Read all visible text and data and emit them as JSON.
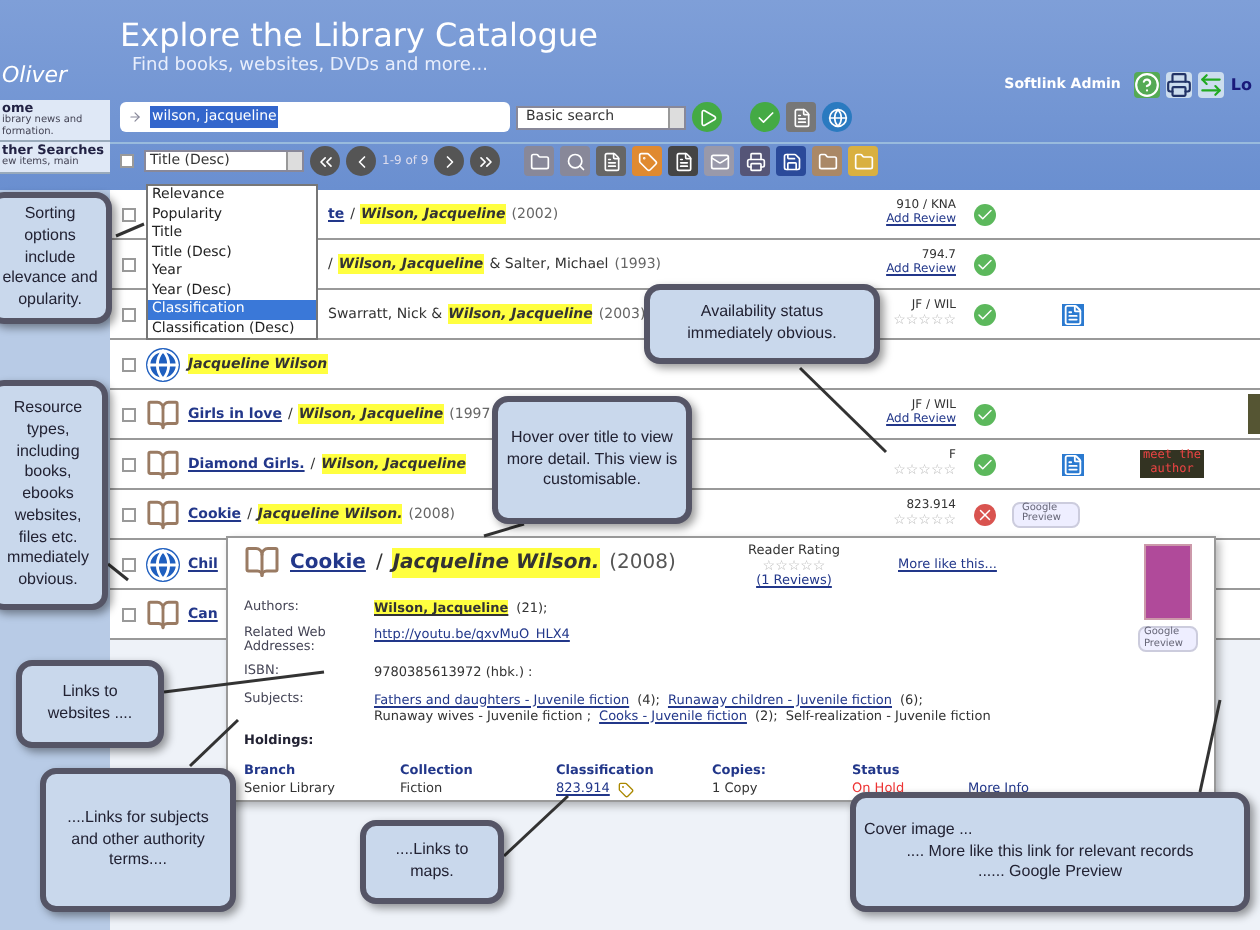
{
  "header": {
    "logo": "Oliver",
    "title": "Explore the Library Catalogue",
    "subtitle": "Find books, websites, DVDs and more...",
    "user": "Softlink Admin",
    "logout": "Lo"
  },
  "sidebar": {
    "items": [
      {
        "label": "ome",
        "description": "ibrary news and formation."
      },
      {
        "label": "ther Searches",
        "description": "ew items, main"
      }
    ]
  },
  "search": {
    "value": "wilson, jacqueline",
    "mode": "Basic search"
  },
  "toolbar": {
    "select_all_checked": false,
    "sort": "Title (Desc)",
    "pager": "1-9 of 9"
  },
  "sort_menu": [
    {
      "label": "Relevance",
      "selected": false
    },
    {
      "label": "Popularity",
      "selected": false
    },
    {
      "label": "Title",
      "selected": false
    },
    {
      "label": "Title (Desc)",
      "selected": false
    },
    {
      "label": "Year",
      "selected": false
    },
    {
      "label": "Year (Desc)",
      "selected": false
    },
    {
      "label": "Classification",
      "selected": true
    },
    {
      "label": "Classification (Desc)",
      "selected": false
    }
  ],
  "results": [
    {
      "checked": false,
      "title": "te",
      "separator": "/",
      "author": "Wilson, Jacqueline",
      "year": "(2002)",
      "call_number": "910 / KNA",
      "review": "Add Review",
      "available": true
    },
    {
      "checked": false,
      "separator": "/",
      "author": "Wilson, Jacqueline",
      "others": "& Salter, Michael",
      "year": "(1993)",
      "call_number": "794.7",
      "review": "Add Review",
      "available": true
    },
    {
      "checked": false,
      "others_before": "Swarratt, Nick &",
      "author": "Wilson, Jacqueline",
      "year": "(2003)",
      "call_number": "JF / WIL",
      "stars": 0,
      "available": true,
      "attachment": true
    },
    {
      "checked": false,
      "kind": "website",
      "author": "Jacqueline Wilson"
    },
    {
      "checked": false,
      "kind": "book",
      "title": "Girls in love",
      "separator": "/",
      "author": "Wilson, Jacqueline",
      "year": "(1997",
      "call_number": "JF / WIL",
      "review": "Add Review",
      "available": true,
      "cover": true
    },
    {
      "checked": false,
      "kind": "book",
      "title": "Diamond Girls.",
      "separator": "/",
      "author": "Wilson, Jacqueline",
      "call_number": "F",
      "stars": 0,
      "available": true,
      "attachment": true,
      "author_image": "meet the author"
    },
    {
      "checked": false,
      "kind": "book",
      "title": "Cookie",
      "separator": "/",
      "author": "Jacqueline Wilson.",
      "year": "(2008)",
      "call_number": "823.914",
      "stars": 0,
      "available": false,
      "preview": "Google Preview"
    },
    {
      "checked": false,
      "kind": "website",
      "title": "Chil"
    },
    {
      "checked": false,
      "kind": "book",
      "title": "Can"
    }
  ],
  "detail": {
    "title": "Cookie",
    "separator": "/",
    "author": "Jacqueline Wilson.",
    "year": "(2008)",
    "rating_label": "Reader Rating",
    "stars": 0,
    "reviews": "(1 Reviews)",
    "more_like": "More like this...",
    "preview": "Google Preview",
    "fields": [
      {
        "label": "Authors:",
        "parts": [
          {
            "text": "Wilson, Jacqueline",
            "kind": "highlight"
          },
          {
            "text": "(21);",
            "kind": "plain"
          }
        ]
      },
      {
        "label": "Related Web Addresses:",
        "parts": [
          {
            "text": "http://youtu.be/qxvMuO_HLX4",
            "kind": "link"
          }
        ]
      },
      {
        "label": "ISBN:",
        "parts": [
          {
            "text": "9780385613972 (hbk.) :",
            "kind": "plain"
          }
        ]
      },
      {
        "label": "Subjects:",
        "parts": [
          {
            "text": "Fathers and daughters - Juvenile fiction",
            "kind": "link"
          },
          {
            "text": "(4);",
            "kind": "plain"
          },
          {
            "text": "Runaway children - Juvenile fiction",
            "kind": "link"
          },
          {
            "text": "(6);",
            "kind": "plain"
          },
          {
            "text": "Runaway wives - Juvenile fiction ;",
            "kind": "plain"
          },
          {
            "text": "Cooks - Juvenile fiction",
            "kind": "link"
          },
          {
            "text": "(2);",
            "kind": "plain"
          },
          {
            "text": "Self-realization - Juvenile fiction",
            "kind": "plain"
          }
        ]
      }
    ],
    "holdings_label": "Holdings:",
    "holdings_columns": [
      "Branch",
      "Collection",
      "Classification",
      "Copies:",
      "Status"
    ],
    "holdings_row": {
      "branch": "Senior Library",
      "collection": "Fiction",
      "classification": "823.914",
      "copies": "1 Copy",
      "status": "On Hold",
      "more": "More Info"
    }
  },
  "callouts": [
    {
      "text": "Sorting options include elevance and opularity."
    },
    {
      "text": "Resource types, including books, ebooks websites, files etc. mmediately obvious."
    },
    {
      "text": "Availability status immediately obvious."
    },
    {
      "text": "Hover over title to view more detail. This view is customisable."
    },
    {
      "text": "Links to websites ...."
    },
    {
      "text": "....Links for subjects and other authority terms...."
    },
    {
      "text": "....Links to maps."
    },
    {
      "lines": [
        "Cover image ...",
        ".... More like this link for relevant records",
        "...... Google Preview"
      ]
    }
  ]
}
